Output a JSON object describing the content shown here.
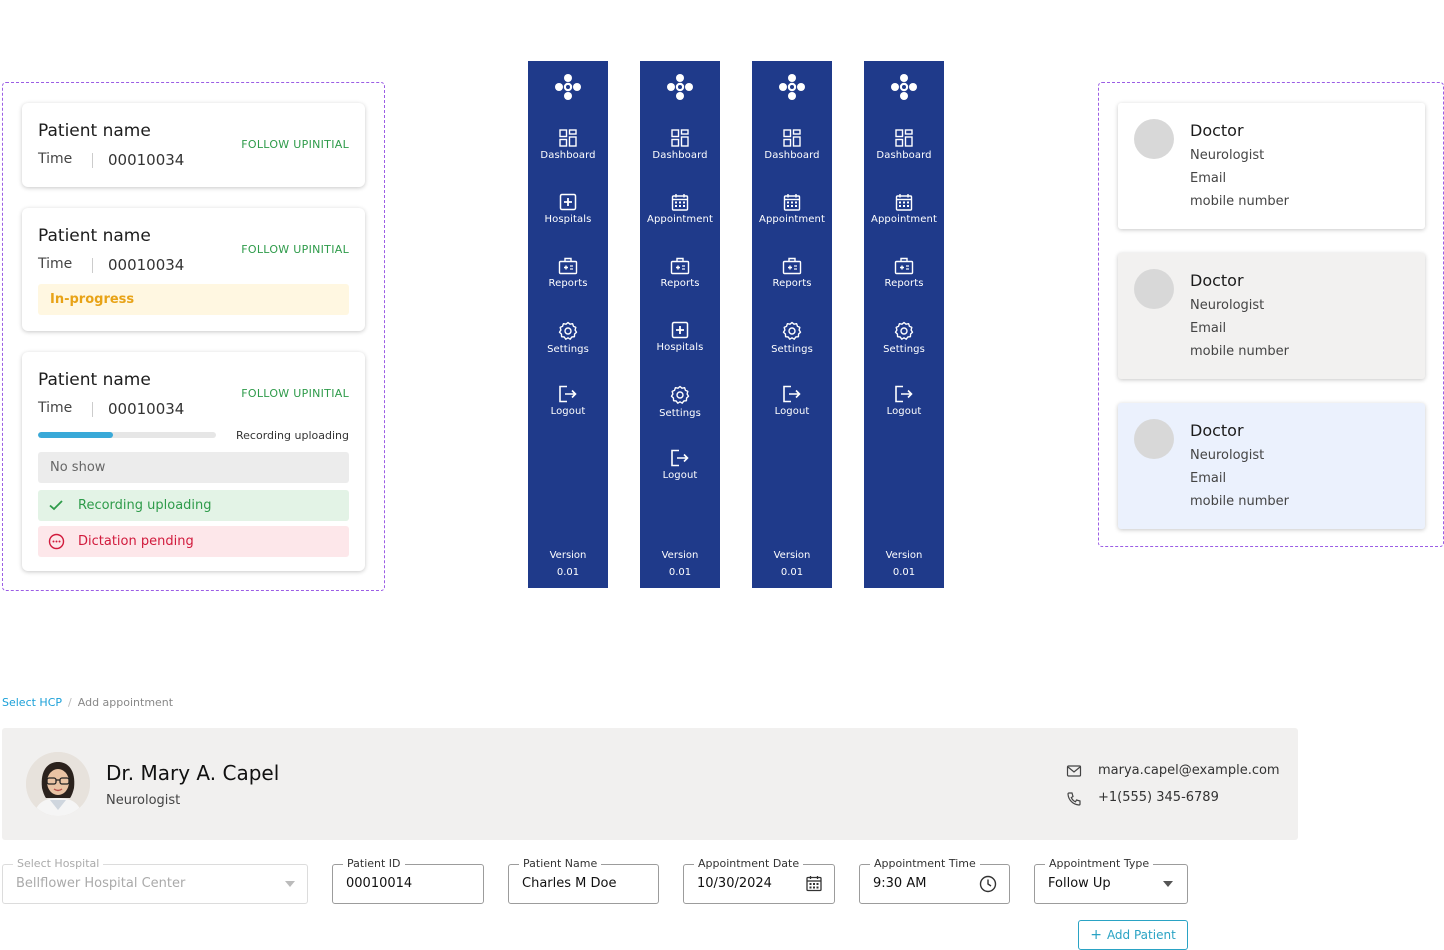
{
  "patient_cards": [
    {
      "name": "Patient name",
      "time_label": "Time",
      "id": "00010034",
      "follow": "FOLLOW UPINITIAL"
    },
    {
      "name": "Patient name",
      "time_label": "Time",
      "id": "00010034",
      "follow": "FOLLOW UPINITIAL",
      "status": "In-progress"
    },
    {
      "name": "Patient name",
      "time_label": "Time",
      "id": "00010034",
      "follow": "FOLLOW UPINITIAL",
      "progress_label": "Recording uploading",
      "progress_fraction": 0.42,
      "status_no_show": "No show",
      "status_recording": "Recording uploading",
      "status_dictation": "Dictation pending"
    }
  ],
  "sidebars": [
    {
      "items": [
        "Dashboard",
        "Hospitals",
        "Reports",
        "Settings",
        "Logout"
      ],
      "icons": [
        "dashboard-icon",
        "hospital-icon",
        "reports-icon",
        "settings-icon",
        "logout-icon"
      ]
    },
    {
      "items": [
        "Dashboard",
        "Appointment",
        "Reports",
        "Hospitals",
        "Settings",
        "Logout"
      ],
      "icons": [
        "dashboard-icon",
        "calendar-icon",
        "reports-icon",
        "hospital-icon",
        "settings-icon",
        "logout-icon"
      ]
    },
    {
      "items": [
        "Dashboard",
        "Appointment",
        "Reports",
        "Settings",
        "Logout"
      ],
      "icons": [
        "dashboard-icon",
        "calendar-icon",
        "reports-icon",
        "settings-icon",
        "logout-icon"
      ]
    },
    {
      "items": [
        "Dashboard",
        "Appointment",
        "Reports",
        "Settings",
        "Logout"
      ],
      "icons": [
        "dashboard-icon",
        "calendar-icon",
        "reports-icon",
        "settings-icon",
        "logout-icon"
      ]
    }
  ],
  "sidebar_version": {
    "label": "Version",
    "number": "0.01"
  },
  "doctor_cards": [
    {
      "title": "Doctor",
      "specialty": "Neurologist",
      "email": "Email",
      "mobile": "mobile number"
    },
    {
      "title": "Doctor",
      "specialty": "Neurologist",
      "email": "Email",
      "mobile": "mobile number"
    },
    {
      "title": "Doctor",
      "specialty": "Neurologist",
      "email": "Email",
      "mobile": "mobile number"
    }
  ],
  "breadcrumb": {
    "link": "Select HCP",
    "separator": "/",
    "current": "Add appointment"
  },
  "hcp": {
    "name": "Dr. Mary A. Capel",
    "specialty": "Neurologist",
    "email": "marya.capel@example.com",
    "phone": "+1(555) 345-6789"
  },
  "form": {
    "hospital": {
      "label": "Select Hospital",
      "value": "Bellflower Hospital Center"
    },
    "patient_id": {
      "label": "Patient ID",
      "value": "00010014"
    },
    "patient_name": {
      "label": "Patient Name",
      "value": "Charles M Doe"
    },
    "appointment_date": {
      "label": "Appointment Date",
      "value": "10/30/2024"
    },
    "appointment_time": {
      "label": "Appointment Time",
      "value": "9:30 AM"
    },
    "appointment_type": {
      "label": "Appointment Type",
      "value": "Follow Up"
    },
    "add_patient_label": "Add Patient"
  },
  "colors": {
    "sidebar": "#1f3a8a",
    "follow_up": "#2e9b4a",
    "in_progress": "#e8a317",
    "dictation": "#d11a3c",
    "progress": "#39a9d8",
    "link": "#1ba0d8",
    "panel_border": "#9b5de5"
  }
}
